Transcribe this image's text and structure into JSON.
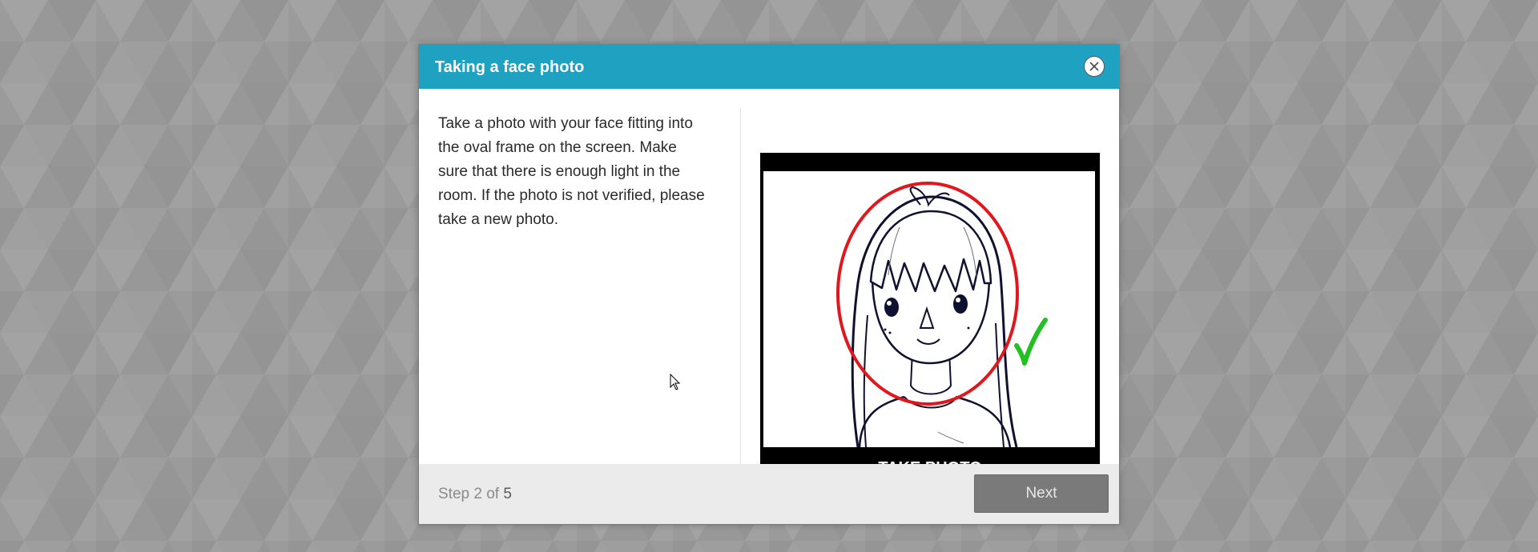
{
  "colors": {
    "header": "#1fa2c2",
    "background": "#9a9a9a",
    "footer": "#ebebeb",
    "next_button": "#7a7a7a",
    "oval_frame": "#e0171c",
    "checkmark": "#22c022"
  },
  "modal": {
    "title": "Taking a face photo",
    "close_icon": "close-icon",
    "instructions": "Take a photo with your face fitting into the oval frame on the screen. Make sure that there is enough light in the room. If the photo is not verified, please take a new photo.",
    "camera": {
      "take_photo_label": "TAKE PHOTO",
      "checkmark_icon": "checkmark-icon"
    },
    "footer": {
      "step_prefix": "Step ",
      "step_current": "2",
      "step_suffix": " of ",
      "step_total": "5",
      "next_label": "Next"
    }
  }
}
